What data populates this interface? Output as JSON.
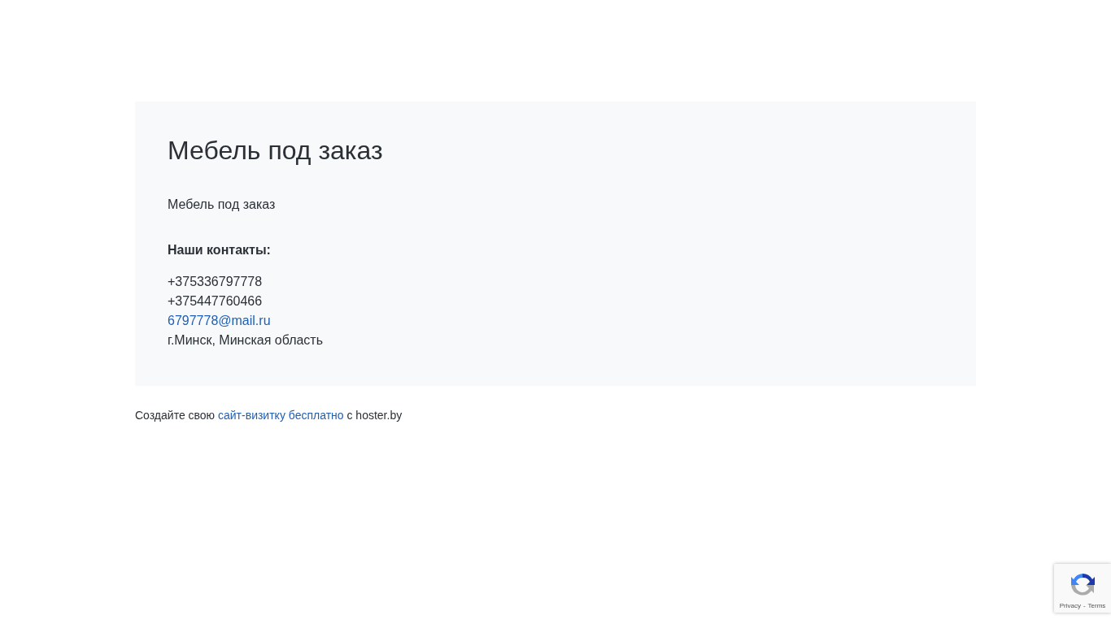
{
  "card": {
    "title": "Мебель под заказ",
    "description": "Мебель под заказ",
    "contacts_heading": "Наши контакты:",
    "contacts": [
      {
        "kind": "text",
        "value": "+375336797778"
      },
      {
        "kind": "text",
        "value": "+375447760466"
      },
      {
        "kind": "link",
        "value": "6797778@mail.ru"
      },
      {
        "kind": "text",
        "value": "г.Минск, Минская область"
      }
    ]
  },
  "footer": {
    "before": "Создайте свою ",
    "link": "сайт-визитку бесплатно",
    "after": " с hoster.by"
  },
  "recaptcha": {
    "privacy": "Privacy",
    "separator": "-",
    "terms": "Terms"
  }
}
